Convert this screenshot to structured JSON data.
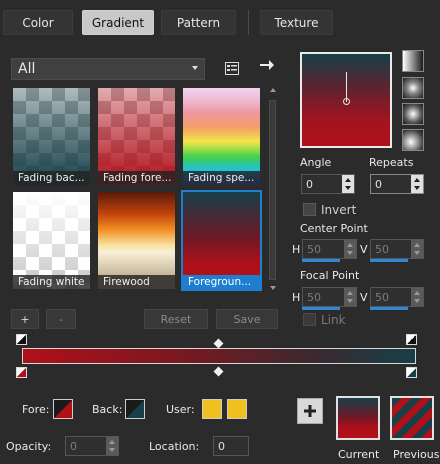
{
  "tabs": [
    {
      "label": "Color",
      "active": false
    },
    {
      "label": "Gradient",
      "active": true
    },
    {
      "label": "Pattern",
      "active": false
    },
    {
      "label": "Texture",
      "active": false
    }
  ],
  "category": {
    "selected": "All"
  },
  "gradients": [
    {
      "name": "Fading bac...",
      "selected": false
    },
    {
      "name": "Fading fore...",
      "selected": false
    },
    {
      "name": "Fading spe...",
      "selected": false
    },
    {
      "name": "Fading white",
      "selected": false
    },
    {
      "name": "Firewood",
      "selected": false
    },
    {
      "name": "Foregroun...",
      "selected": true
    }
  ],
  "list_buttons": {
    "add": "+",
    "remove": "-",
    "reset": "Reset",
    "save": "Save"
  },
  "angle": {
    "label": "Angle",
    "value": "0"
  },
  "repeats": {
    "label": "Repeats",
    "value": "0"
  },
  "invert": {
    "label": "Invert",
    "checked": false
  },
  "center_point": {
    "label": "Center Point",
    "h_label": "H",
    "h_value": "50",
    "v_label": "V",
    "v_value": "50"
  },
  "focal_point": {
    "label": "Focal Point",
    "h_label": "H",
    "h_value": "50",
    "v_label": "V",
    "v_value": "50"
  },
  "link": {
    "label": "Link",
    "checked": false
  },
  "colors": {
    "foreground": "#b0101a",
    "background": "#173f48",
    "user_1": "#f0c020",
    "user_2": "#f0c020",
    "accent": "#1e7fd0"
  },
  "bottom": {
    "fore_label": "Fore:",
    "back_label": "Back:",
    "user_label": "User:",
    "opacity_label": "Opacity:",
    "opacity_value": "0",
    "location_label": "Location:",
    "location_value": "0",
    "current_label": "Current",
    "previous_label": "Previous"
  },
  "icons": {
    "list_menu": "list-menu-icon",
    "arrow": "arrow-right-icon",
    "add_to_history": "plus-icon"
  }
}
